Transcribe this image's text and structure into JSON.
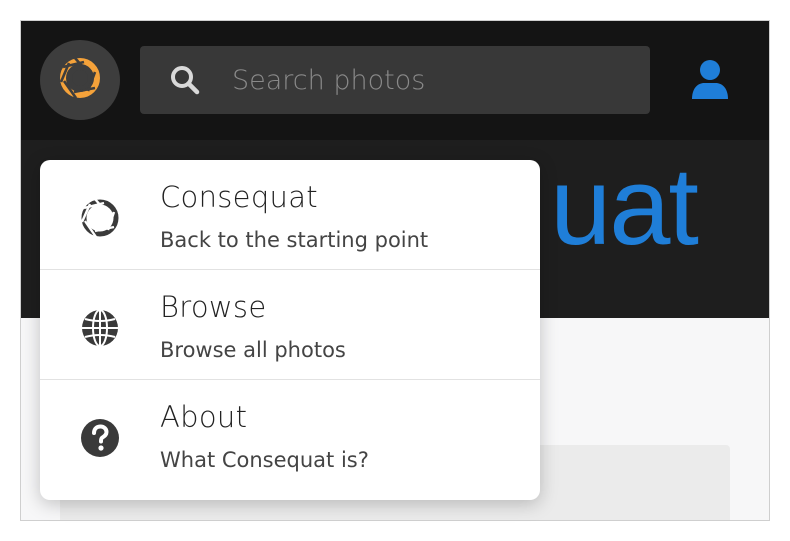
{
  "app": {
    "brand_name": "Consequat",
    "hero_partial_text": "uat"
  },
  "header": {
    "search": {
      "placeholder": "Search photos",
      "value": ""
    }
  },
  "menu": {
    "items": [
      {
        "title": "Consequat",
        "subtitle": "Back to the starting point",
        "icon": "aperture-icon"
      },
      {
        "title": "Browse",
        "subtitle": "Browse all photos",
        "icon": "globe-icon"
      },
      {
        "title": "About",
        "subtitle": "What Consequat is?",
        "icon": "question-circle-icon"
      }
    ]
  },
  "colors": {
    "accent_orange": "#f5a23a",
    "brand_blue": "#1f7ed8",
    "topbar_bg": "#141414",
    "hero_bg": "#1e1e1e"
  }
}
